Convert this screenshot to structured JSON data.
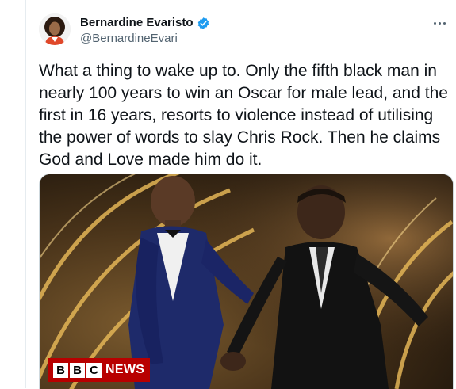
{
  "author": {
    "display_name": "Bernardine Evaristo",
    "handle": "@BernardineEvari",
    "verified_icon": "verified-badge-icon",
    "verified_color": "#1d9bf0"
  },
  "menu": {
    "icon": "more-options-icon"
  },
  "tweet": {
    "text": "What a thing to wake up to. Only the fifth black man in\nnearly 100 years to win an Oscar for male lead, and the\nfirst in 16 years, resorts to violence instead of utilising\nthe power of words to slay Chris Rock. Then he claims\nGod and Love made him do it."
  },
  "media": {
    "watermark": {
      "blocks": [
        "B",
        "B",
        "C"
      ],
      "label": "NEWS",
      "color": "#b80000"
    }
  },
  "colors": {
    "text_primary": "#0f1419",
    "text_secondary": "#536471",
    "border": "#cfd9de"
  }
}
